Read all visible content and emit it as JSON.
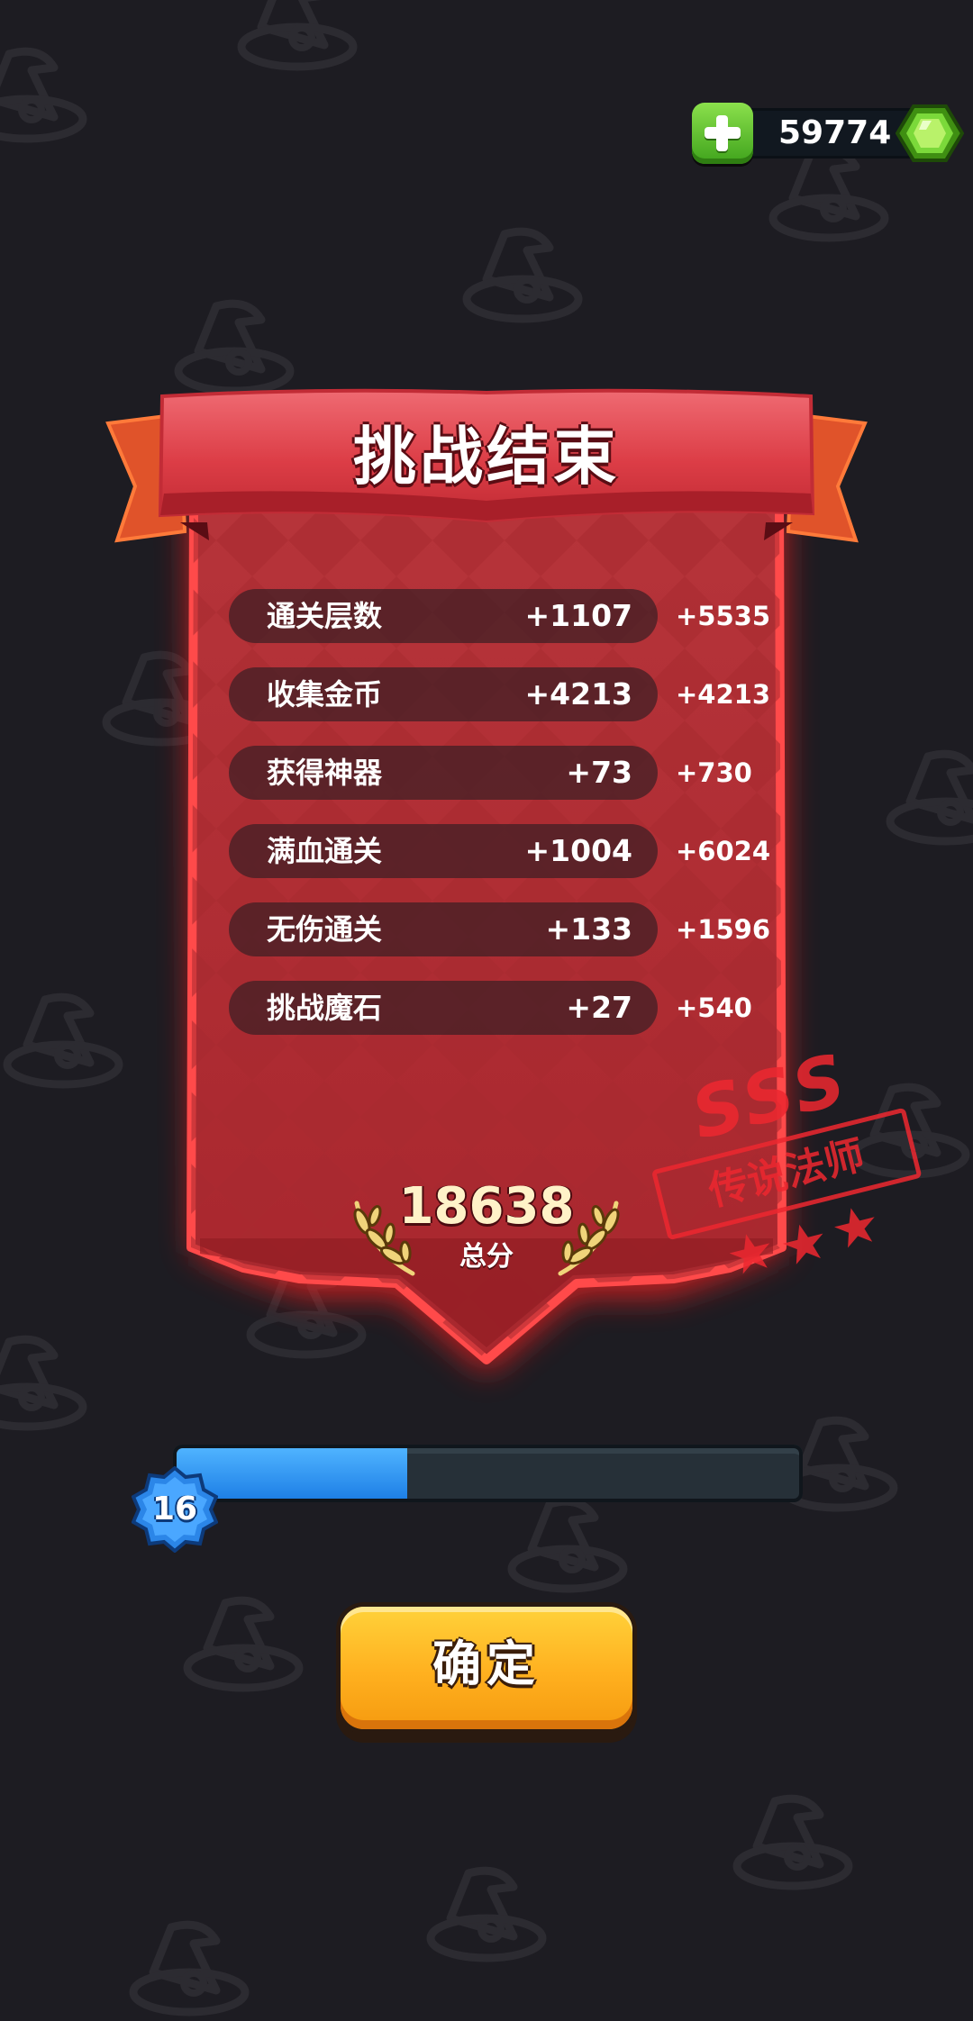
{
  "currency": {
    "gems": "59774",
    "icon": "green-gem-icon",
    "add_icon": "plus-icon"
  },
  "panel": {
    "title": "挑战结束",
    "rows": [
      {
        "label": "通关层数",
        "score": "+1107",
        "bonus": "+5535"
      },
      {
        "label": "收集金币",
        "score": "+4213",
        "bonus": "+4213"
      },
      {
        "label": "获得神器",
        "score": "+73",
        "bonus": "+730"
      },
      {
        "label": "满血通关",
        "score": "+1004",
        "bonus": "+6024"
      },
      {
        "label": "无伤通关",
        "score": "+133",
        "bonus": "+1596"
      },
      {
        "label": "挑战魔石",
        "score": "+27",
        "bonus": "+540"
      }
    ],
    "total_value": "18638",
    "total_label": "总分"
  },
  "stamp": {
    "grade": "SSS",
    "title": "传说法师",
    "stars": 3
  },
  "level": {
    "number": "16",
    "progress": 0.37
  },
  "confirm_label": "确定",
  "colors": {
    "background": "#1d1c22",
    "panel_red": "#c8383c",
    "glow": "#ff2a2a",
    "progress_blue": "#2a8ff0",
    "button_yellow": "#ffb01f",
    "gem_green": "#6fd52a"
  }
}
